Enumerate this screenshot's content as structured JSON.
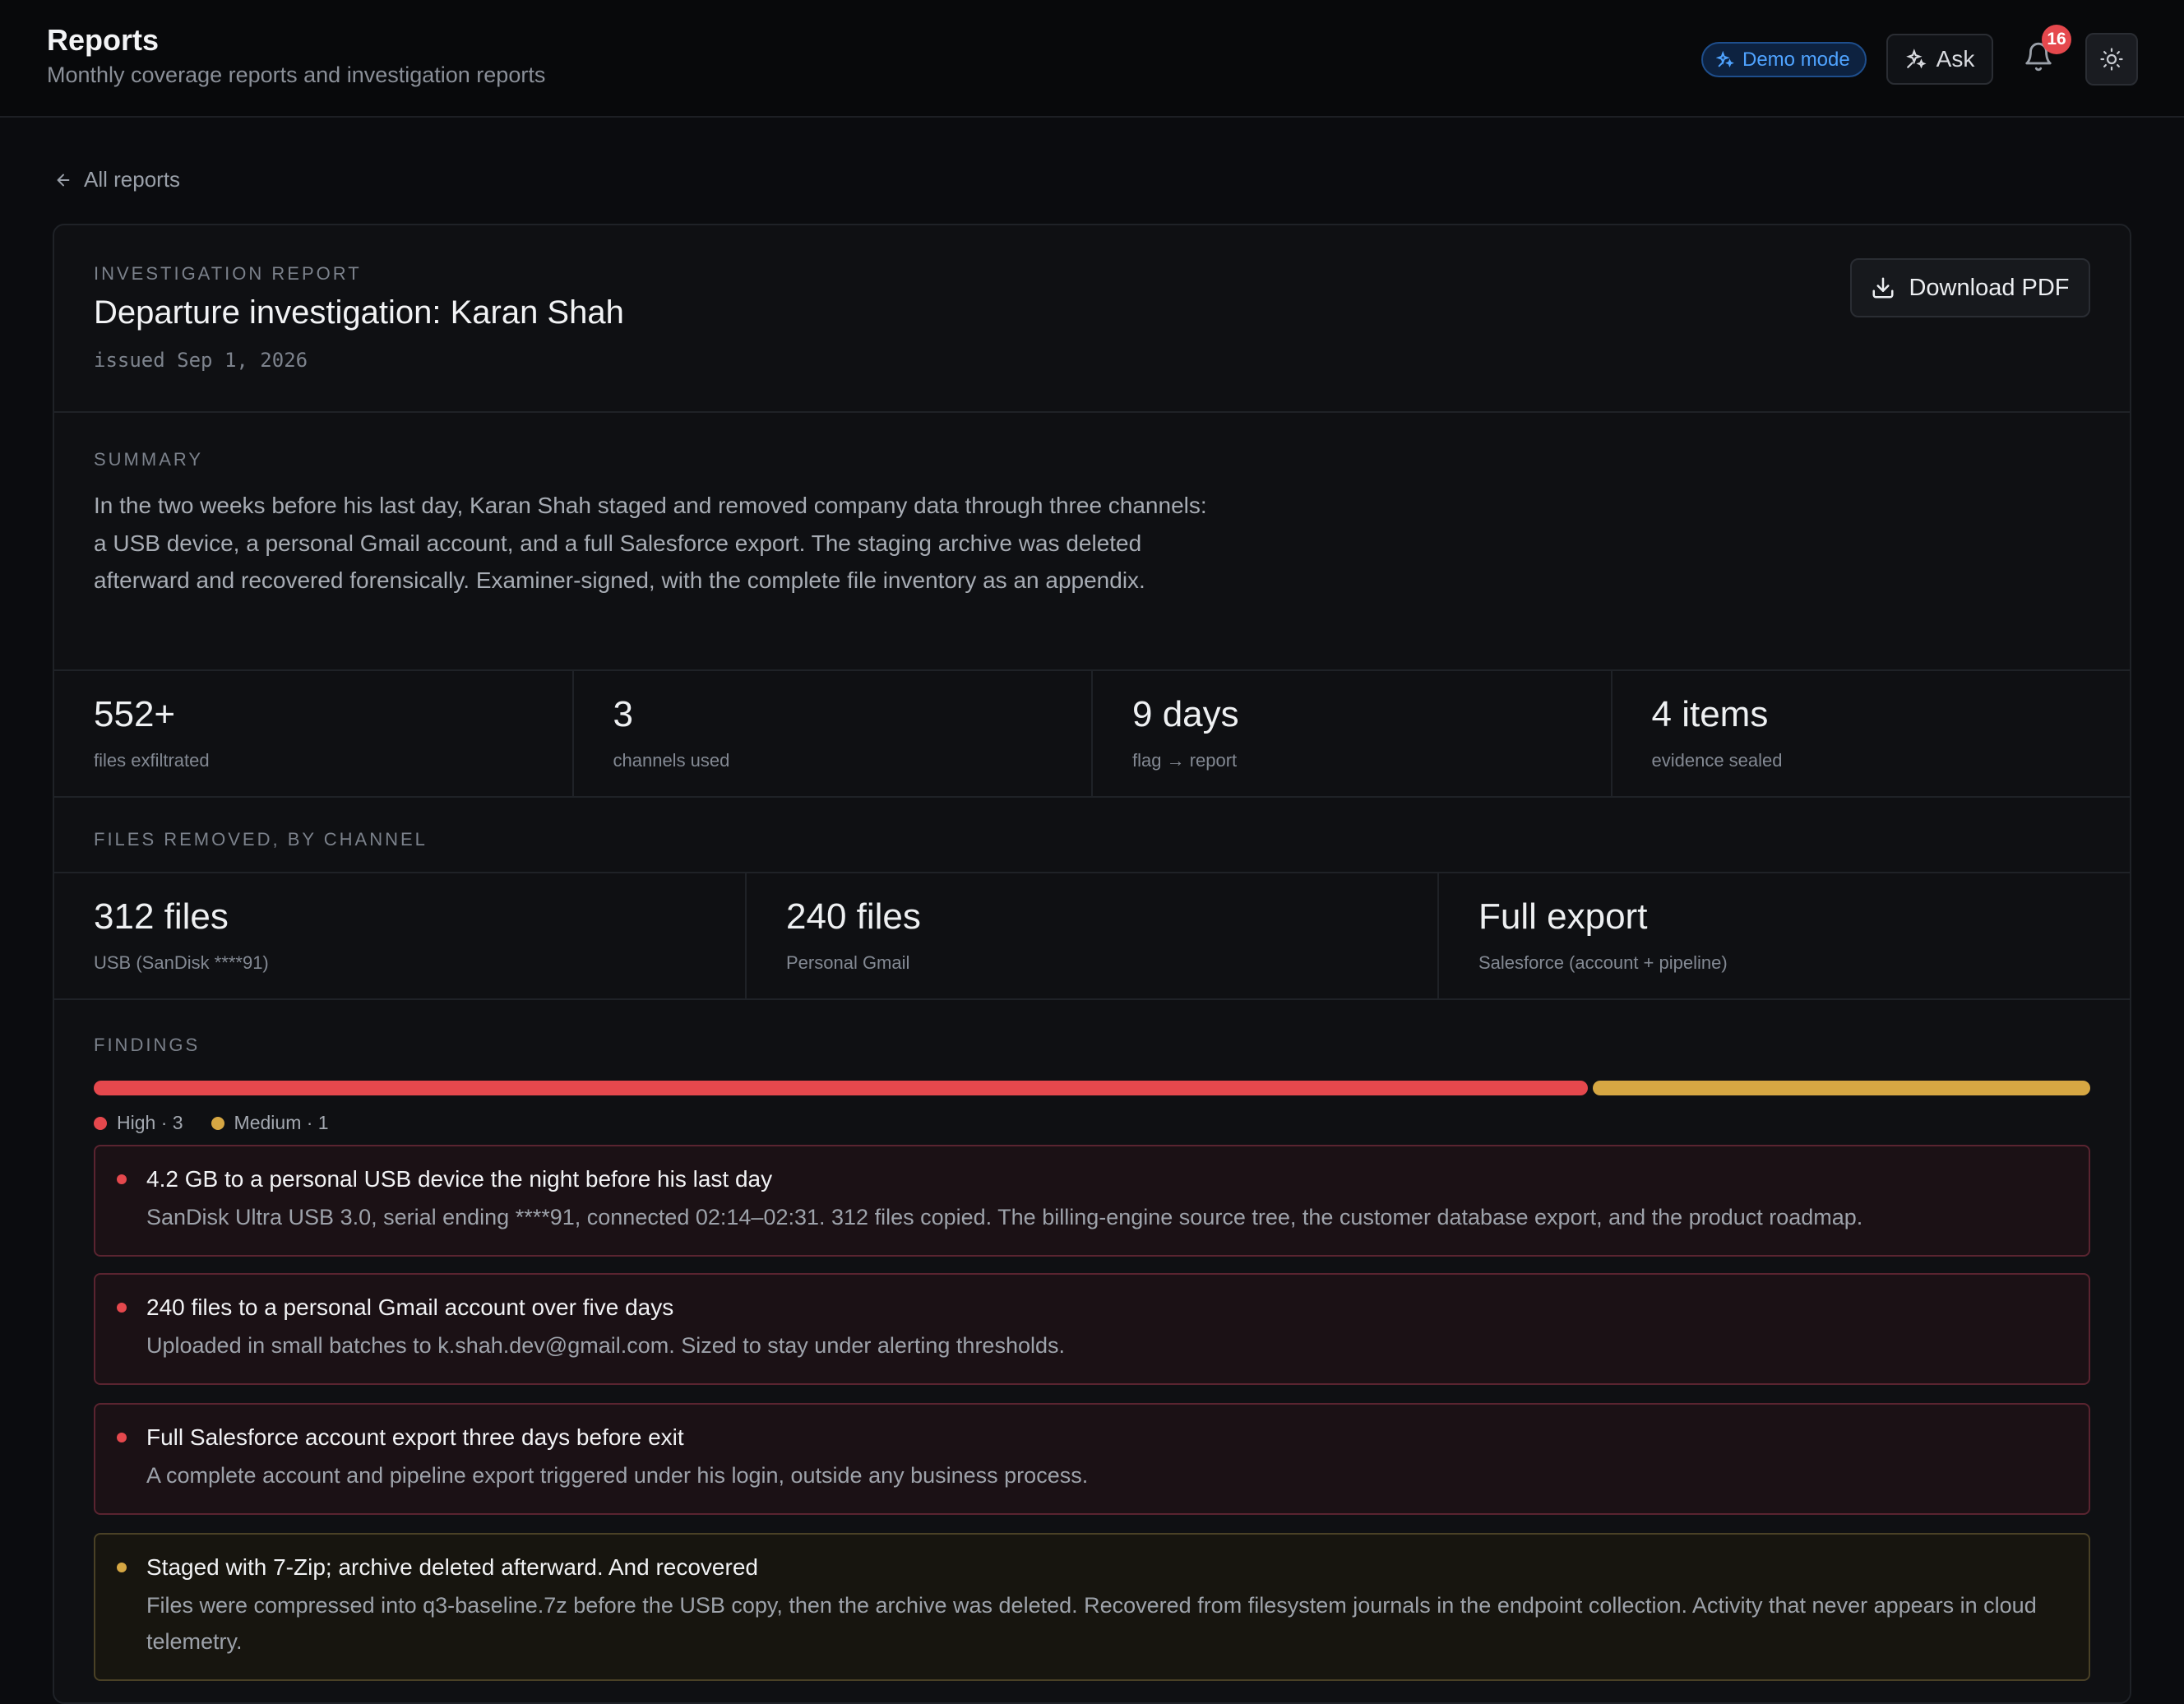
{
  "header": {
    "title": "Reports",
    "subtitle": "Monthly coverage reports and investigation reports",
    "demo_badge": "Demo mode",
    "ask_label": "Ask",
    "notification_count": "16"
  },
  "back_link": "All reports",
  "report": {
    "eyebrow": "INVESTIGATION REPORT",
    "title": "Departure investigation: Karan Shah",
    "issued": "issued Sep 1, 2026",
    "download_label": "Download PDF"
  },
  "summary": {
    "eyebrow": "SUMMARY",
    "text": "In the two weeks before his last day, Karan Shah staged and removed company data through three channels: a USB device, a personal Gmail account, and a full Salesforce export. The staging archive was deleted afterward and recovered forensically. Examiner-signed, with the complete file inventory as an appendix."
  },
  "stats": [
    {
      "value": "552+",
      "label": "files exfiltrated"
    },
    {
      "value": "3",
      "label": "channels used"
    },
    {
      "value": "9 days",
      "label": "flag → report"
    },
    {
      "value": "4 items",
      "label": "evidence sealed"
    }
  ],
  "channels": {
    "eyebrow": "FILES REMOVED, BY CHANNEL",
    "items": [
      {
        "value": "312 files",
        "label": "USB (SanDisk ****91)"
      },
      {
        "value": "240 files",
        "label": "Personal Gmail"
      },
      {
        "value": "Full export",
        "label": "Salesforce (account + pipeline)"
      }
    ]
  },
  "findings": {
    "eyebrow": "FINDINGS",
    "severity": [
      {
        "name": "High",
        "count": 3,
        "legend": "High · 3",
        "color": "#e5484d"
      },
      {
        "name": "Medium",
        "count": 1,
        "legend": "Medium · 1",
        "color": "#d6a743"
      }
    ],
    "items": [
      {
        "severity": "high",
        "title": "4.2 GB to a personal USB device the night before his last day",
        "desc": "SanDisk Ultra USB 3.0, serial ending ****91, connected 02:14–02:31. 312 files copied. The billing-engine source tree, the customer database export, and the product roadmap."
      },
      {
        "severity": "high",
        "title": "240 files to a personal Gmail account over five days",
        "desc": "Uploaded in small batches to k.shah.dev@gmail.com. Sized to stay under alerting thresholds."
      },
      {
        "severity": "high",
        "title": "Full Salesforce account export three days before exit",
        "desc": "A complete account and pipeline export triggered under his login, outside any business process."
      },
      {
        "severity": "medium",
        "title": "Staged with 7-Zip; archive deleted afterward. And recovered",
        "desc": "Files were compressed into q3-baseline.7z before the USB copy, then the archive was deleted. Recovered from filesystem journals in the endpoint collection. Activity that never appears in cloud telemetry."
      }
    ]
  },
  "icons": {
    "demo": "sparkle-icon",
    "ask": "sparkle-icon",
    "notifications": "bell-icon",
    "theme": "sun-icon",
    "back": "arrow-left-icon",
    "download": "download-icon"
  }
}
